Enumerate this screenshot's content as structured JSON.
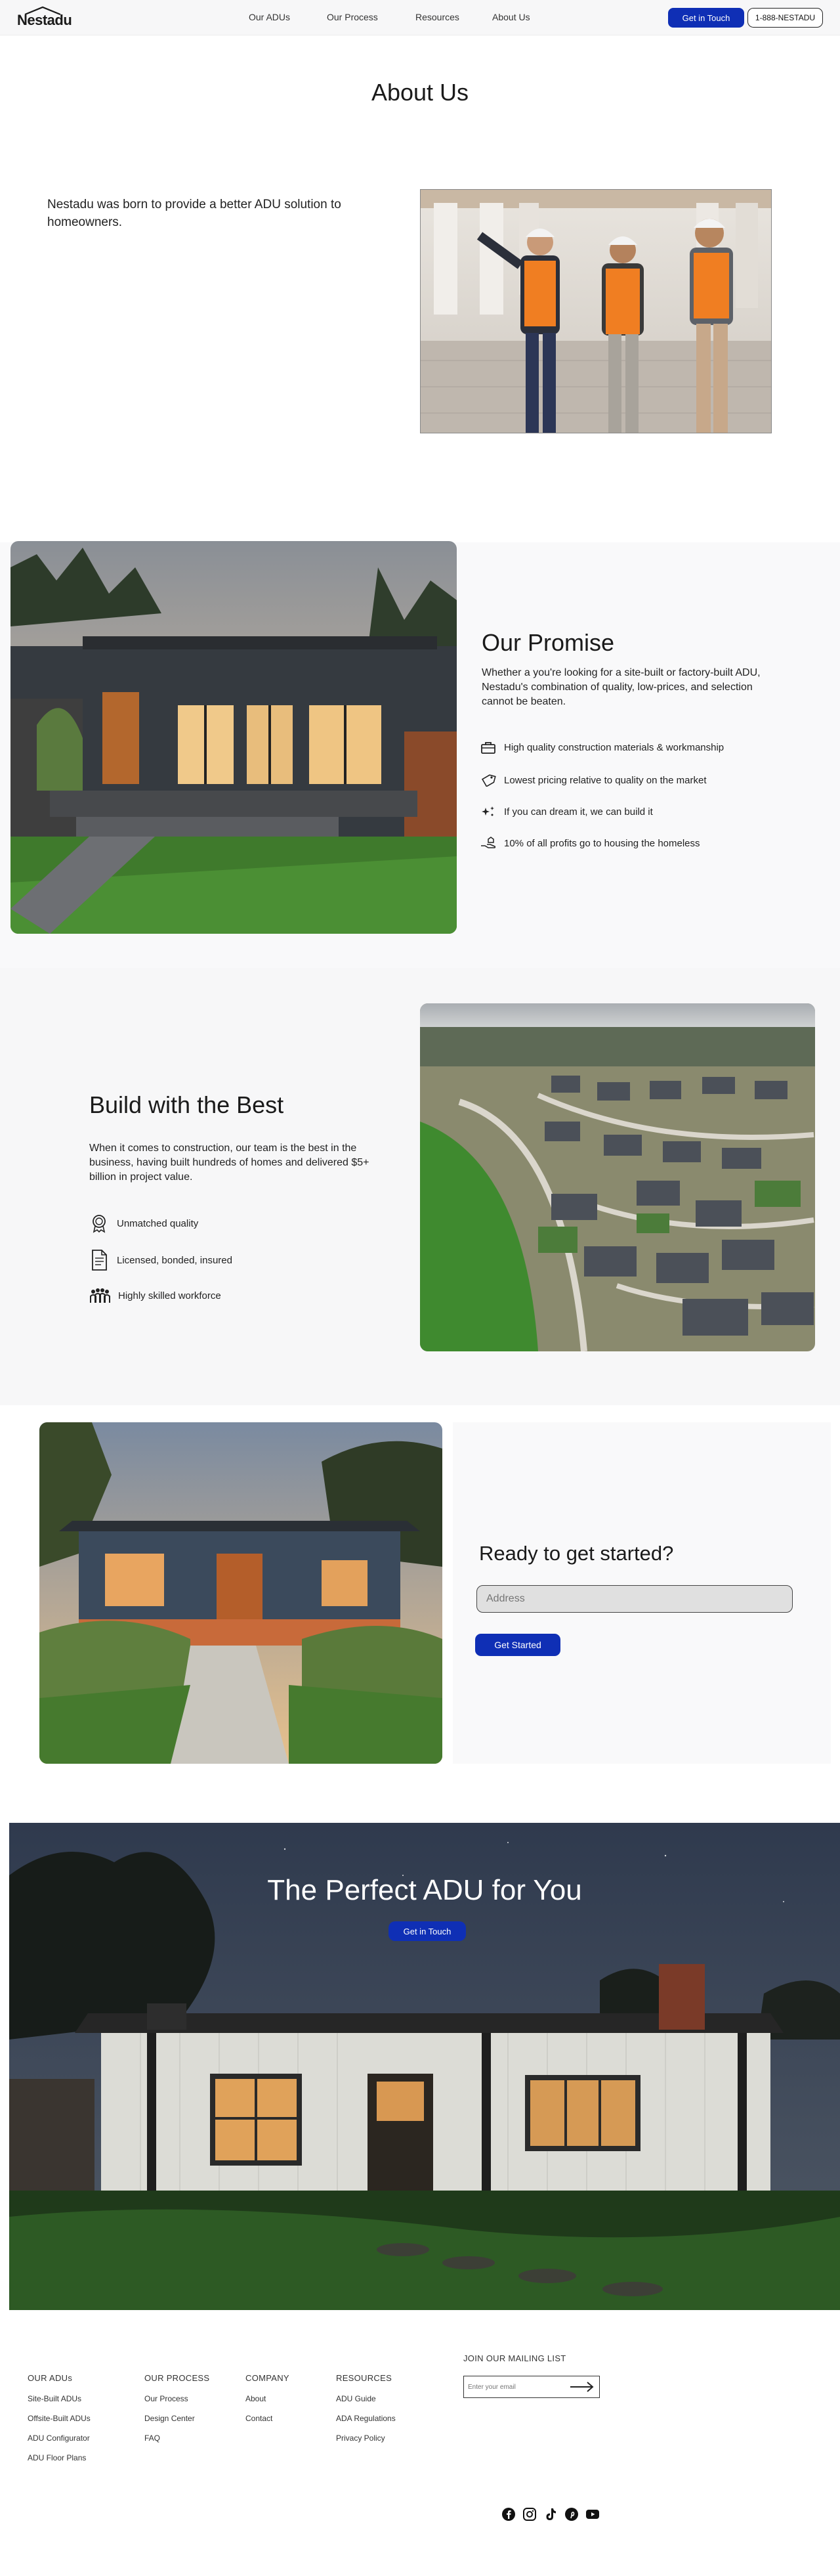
{
  "header": {
    "logo": "Nestadu",
    "nav": [
      "Our ADUs",
      "Our Process",
      "Resources",
      "About Us"
    ],
    "cta_button": "Get in Touch",
    "phone_button": "1-888-NESTADU"
  },
  "about": {
    "title": "About Us",
    "intro": "Nestadu was born to provide a better ADU solution to homeowners."
  },
  "promise": {
    "title": "Our Promise",
    "body": "Whether a you're looking for a site-built or factory-built ADU, Nestadu's combination of quality, low-prices, and selection cannot be beaten.",
    "features": [
      {
        "icon": "toolbox-icon",
        "text": "High quality construction materials & workmanship"
      },
      {
        "icon": "price-tag-icon",
        "text": "Lowest pricing relative to quality on the market"
      },
      {
        "icon": "sparkle-icon",
        "text": "If you can dream it, we can build it"
      },
      {
        "icon": "helping-hand-icon",
        "text": "10% of all profits go to housing the homeless"
      }
    ]
  },
  "build": {
    "title": "Build with the Best",
    "body": "When it comes to construction, our team is the best in the business, having built hundreds of homes and delivered $5+ billion in project value.",
    "features": [
      {
        "icon": "award-badge-icon",
        "text": "Unmatched quality"
      },
      {
        "icon": "document-icon",
        "text": "Licensed, bonded, insured"
      },
      {
        "icon": "workforce-icon",
        "text": "Highly skilled workforce"
      }
    ]
  },
  "started": {
    "title": "Ready to get started?",
    "address_placeholder": "Address",
    "button": "Get Started"
  },
  "hero": {
    "title": "The Perfect ADU for You",
    "button": "Get in Touch"
  },
  "footer": {
    "columns": [
      {
        "heading": "OUR ADUs",
        "links": [
          "Site-Built ADUs",
          "Offsite-Built ADUs",
          "ADU Configurator",
          "ADU Floor Plans"
        ]
      },
      {
        "heading": "OUR PROCESS",
        "links": [
          "Our Process",
          "Design Center",
          "FAQ"
        ]
      },
      {
        "heading": "COMPANY",
        "links": [
          "About",
          "Contact"
        ]
      },
      {
        "heading": "RESOURCES",
        "links": [
          "ADU Guide",
          "ADA Regulations",
          "Privacy Policy"
        ]
      }
    ],
    "mailing_heading": "JOIN OUR MAILING LIST",
    "email_placeholder": "Enter your email",
    "social": [
      "facebook-icon",
      "instagram-icon",
      "tiktok-icon",
      "pinterest-icon",
      "youtube-icon"
    ]
  },
  "colors": {
    "accent": "#0f2fb5",
    "band": "#f9f9fa",
    "text": "#222222"
  }
}
